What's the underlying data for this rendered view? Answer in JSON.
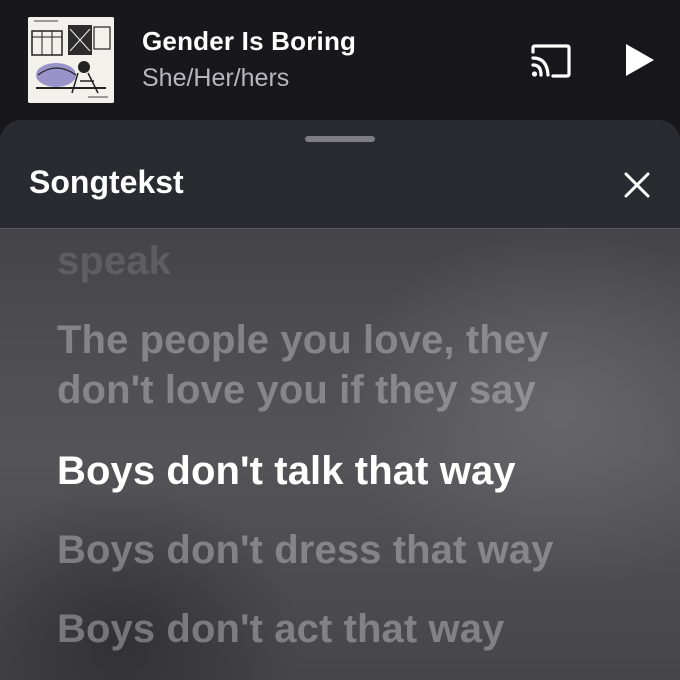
{
  "mini_player": {
    "title": "Gender Is Boring",
    "artist": "She/Her/hers",
    "cast_icon": "cast-icon",
    "play_icon": "play-icon"
  },
  "lyrics_sheet": {
    "title": "Songtekst",
    "close_icon": "close-icon",
    "lines": [
      "speak",
      "The people you love, they",
      "don't love you if they say",
      "Boys don't talk that way",
      "Boys don't dress that way",
      "Boys don't act that way"
    ],
    "active_line_index": 3
  },
  "colors": {
    "header_bg": "#18171c",
    "sheet_header_bg": "#2a2a31",
    "active_lyric": "#ffffff",
    "inactive_lyric": "#9b9ba0"
  }
}
